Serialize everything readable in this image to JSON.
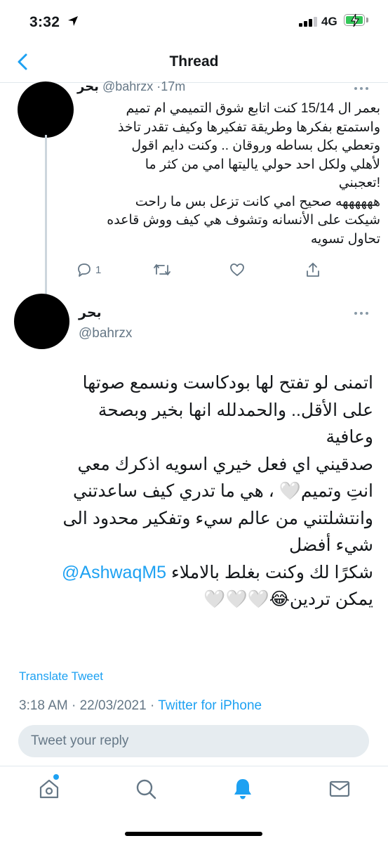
{
  "status_bar": {
    "time": "3:32",
    "network": "4G"
  },
  "nav": {
    "title": "Thread"
  },
  "parent_tweet": {
    "author_name": "بحر",
    "handle": "@bahrzx",
    "separator": "·",
    "time_ago": "17m",
    "lines": [
      "بعمر ال 15/14 كنت اتابع شوق التميمي ام تميم",
      "واستمتع بفكرها وطريقة تفكيرها وكيف تقدر تاخذ",
      "وتعطي بكل بساطه وروقان .. وكنت دايم اقول",
      "لأهلي ولكل احد حولي ياليتها امي من كثر ما",
      "!تعجبني",
      "ههههههه صحيح امي كانت تزعل بس ما راحت",
      "شيكت على الأنسانه وتشوف هي كيف ووش قاعده",
      "تحاول تسويه"
    ],
    "reply_count": "1"
  },
  "main_tweet": {
    "author_name": "بحر",
    "handle": "@bahrzx",
    "lines": [
      "اتمنى لو تفتح لها بودكاست ونسمع صوتها",
      "على الأقل.. والحمدلله انها بخير وبصحة",
      "وعافية",
      "صدقيني اي فعل خيري اسويه اذكرك معي",
      "انتِ وتميم🤍 ، هي ما تدري كيف ساعدتني",
      "وانتشلتني من عالم سيء وتفكير محدود الى",
      "شيء أفضل"
    ],
    "mention": "@AshwaqM5",
    "mention_line_text": " شكرًا لك وكنت بغلط بالاملاء",
    "last_line_text": "يمكن تردين",
    "last_line_emoji": "😂🤍🤍🤍",
    "translate": "Translate Tweet",
    "timestamp": "3:18 AM · 22/03/2021 · ",
    "source": "Twitter for iPhone"
  },
  "reply_bar": {
    "placeholder": "Tweet your reply"
  },
  "tab_bar": {
    "items": [
      {
        "name": "home",
        "icon": "home-icon",
        "has_badge": true
      },
      {
        "name": "search",
        "icon": "search-icon"
      },
      {
        "name": "notifications",
        "icon": "bell-icon",
        "active": true
      },
      {
        "name": "messages",
        "icon": "mail-icon"
      }
    ]
  },
  "colors": {
    "accent": "#1da1f2",
    "muted_text": "#657786",
    "primary_text": "#14171a",
    "reply_bar_bg": "#e6ecf0",
    "battery": "#34c759"
  }
}
